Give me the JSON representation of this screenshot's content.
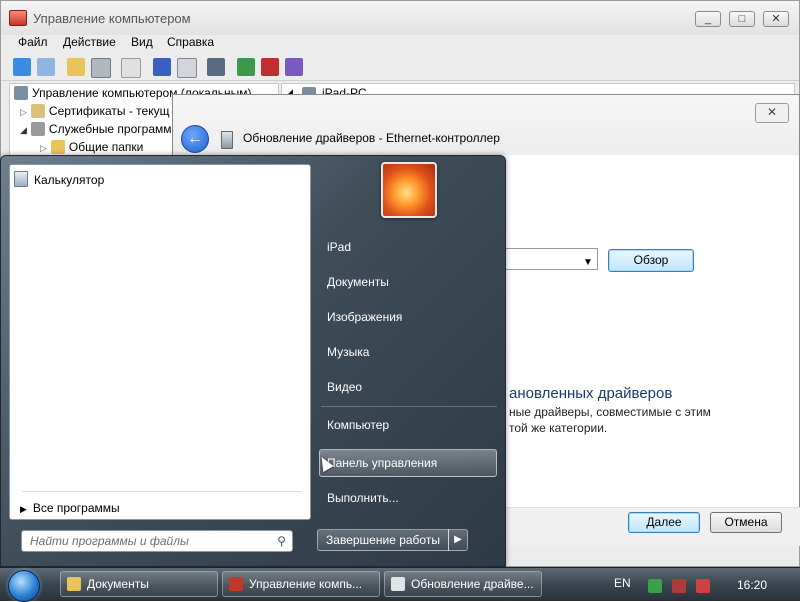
{
  "computer_management": {
    "title": "Управление компьютером",
    "menu": [
      "Файл",
      "Действие",
      "Вид",
      "Справка"
    ],
    "tree": [
      {
        "label": "Управление компьютером (локальным)",
        "icon": "computer-icon"
      },
      {
        "label": "Сертификаты - текущ",
        "icon": "certificate-icon"
      },
      {
        "label": "Служебные программ",
        "icon": "tools-icon"
      },
      {
        "label": "Общие папки",
        "icon": "shared-folder-icon"
      }
    ],
    "right_pane_item": "iPad-PC"
  },
  "driver_dialog": {
    "caption": "Обновление драйверов - Ethernet-контроллер",
    "browse_label": "Обзор",
    "heading": "ановленных драйверов",
    "desc_line1": "ные драйверы, совместимые с этим",
    "desc_line2": "той же категории.",
    "next_label": "Далее",
    "cancel_label": "Отмена"
  },
  "start_menu": {
    "pinned": [
      {
        "label": "Калькулятор",
        "icon": "calculator-icon"
      }
    ],
    "all_programs": "Все программы",
    "search_placeholder": "Найти программы и файлы",
    "right_links": [
      "iPad",
      "Документы",
      "Изображения",
      "Музыка",
      "Видео",
      "Компьютер",
      "Панель управления",
      "Выполнить..."
    ],
    "highlighted": "Панель управления",
    "shutdown_label": "Завершение работы"
  },
  "taskbar": {
    "items": [
      {
        "label": "Документы",
        "icon": "folder-icon"
      },
      {
        "label": "Управление компь...",
        "icon": "computer-management-icon"
      },
      {
        "label": "Обновление драйве...",
        "icon": "device-icon"
      }
    ],
    "language": "EN",
    "clock": "16:20"
  },
  "colors": {
    "start_menu_dark": "#2e3a45",
    "taskbar": "#3a444e",
    "dialog_heading": "#1a3a6e",
    "focus_button": "#bee6fd"
  }
}
